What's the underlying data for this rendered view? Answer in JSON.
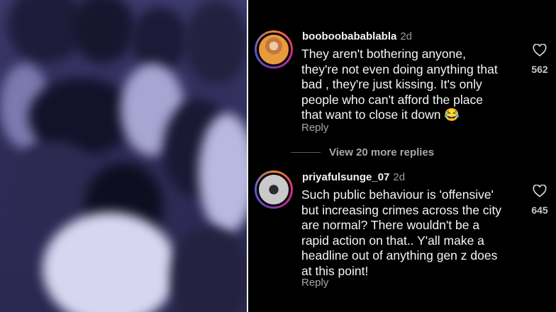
{
  "comments": [
    {
      "username": "booboobabablabla",
      "time": "2d",
      "lines": [
        "They aren't bothering anyone,",
        "they're not even doing anything that",
        "bad , they're just kissing. It's only",
        "people who can't afford the place",
        "that want to close it down 😂"
      ],
      "reply_label": "Reply",
      "likes": "562"
    },
    {
      "username": "priyafulsunge_07",
      "time": "2d",
      "lines": [
        "Such public behaviour is 'offensive'",
        "but increasing crimes across the city",
        "are normal? There wouldn't be a",
        "rapid action on that.. Y'all make a",
        "headline out of anything gen z does",
        "at this point!"
      ],
      "reply_label": "Reply",
      "likes": "645"
    }
  ],
  "view_more_replies": "View 20 more replies",
  "colors": {
    "background": "#000000",
    "text": "#f5f5f5",
    "muted": "#a8a8a8",
    "video_tint": "#3d3a6e"
  }
}
